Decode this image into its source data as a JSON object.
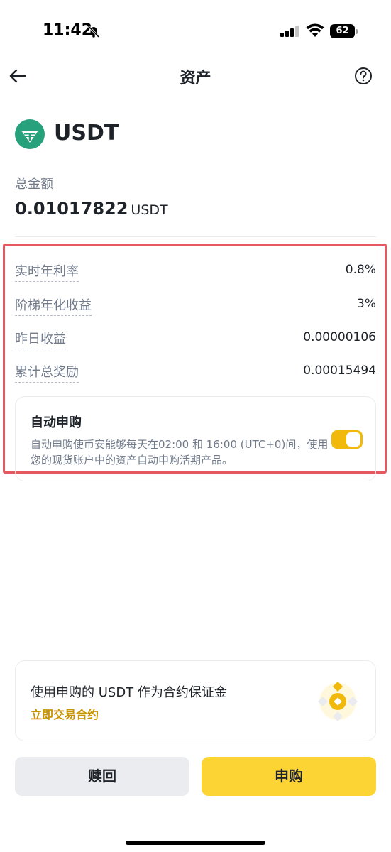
{
  "status_bar": {
    "time": "11:42",
    "battery": "62"
  },
  "nav": {
    "title": "资产"
  },
  "coin": {
    "name": "USDT",
    "logo_color": "#26a17b"
  },
  "total": {
    "label": "总金额",
    "value": "0.01017822",
    "unit": "USDT"
  },
  "rows": [
    {
      "label": "实时年利率",
      "value": "0.8%"
    },
    {
      "label": "阶梯年化收益",
      "value": "3%"
    },
    {
      "label": "昨日收益",
      "value": "0.00000106"
    },
    {
      "label": "累计总奖励",
      "value": "0.00015494"
    }
  ],
  "auto_subscribe": {
    "title": "自动申购",
    "description": "自动申购使币安能够每天在02:00 和 16:00 (UTC+0)间，使用您的现货账户中的资产自动申购活期产品。",
    "enabled": true
  },
  "promo": {
    "title": "使用申购的 USDT 作为合约保证金",
    "link": "立即交易合约"
  },
  "buttons": {
    "redeem": "赎回",
    "subscribe": "申购"
  },
  "colors": {
    "accent": "#f0b90b",
    "primary_button": "#fcd535",
    "highlight_border": "#e5585f"
  }
}
